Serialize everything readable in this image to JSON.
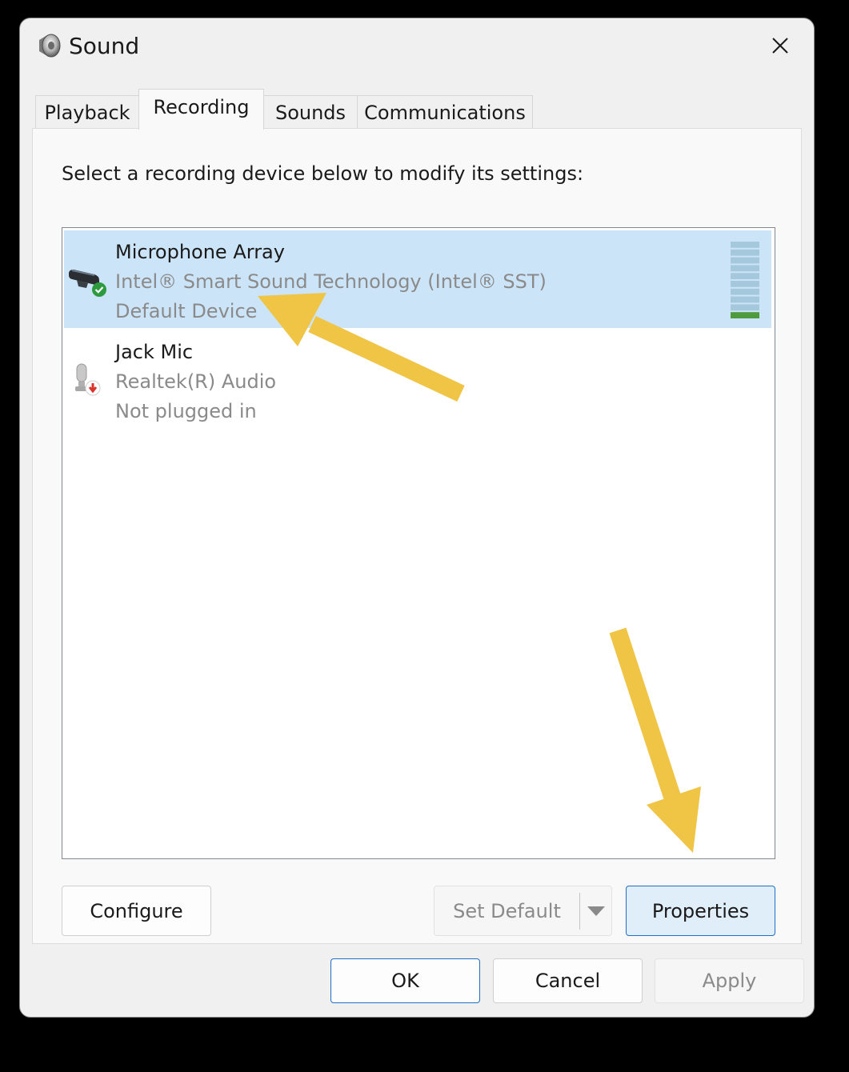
{
  "window": {
    "title": "Sound",
    "close_icon": "close-icon",
    "title_icon": "speaker-icon"
  },
  "tabs": [
    {
      "label": "Playback",
      "active": false
    },
    {
      "label": "Recording",
      "active": true
    },
    {
      "label": "Sounds",
      "active": false
    },
    {
      "label": "Communications",
      "active": false
    }
  ],
  "recording": {
    "instruction": "Select a recording device below to modify its settings:",
    "devices": [
      {
        "name": "Microphone Array",
        "driver": "Intel® Smart Sound Technology (Intel® SST)",
        "status": "Default Device",
        "selected": true,
        "icon": "microphone-array-icon",
        "badge": "default-check-badge"
      },
      {
        "name": "Jack Mic",
        "driver": "Realtek(R) Audio",
        "status": "Not plugged in",
        "selected": false,
        "icon": "microphone-icon",
        "badge": "unplugged-badge"
      }
    ],
    "level_meter_fraction": 0.1
  },
  "buttons": {
    "configure": "Configure",
    "set_default": "Set Default",
    "properties": "Properties",
    "ok": "OK",
    "cancel": "Cancel",
    "apply": "Apply"
  },
  "colors": {
    "selection": "#cce4f7",
    "annotation_arrow": "#f0c445",
    "meter_bar": "#a6c8dc",
    "meter_active": "#4e9a3c",
    "check_badge": "#2e9a3e",
    "unplugged_badge": "#d9342b"
  }
}
